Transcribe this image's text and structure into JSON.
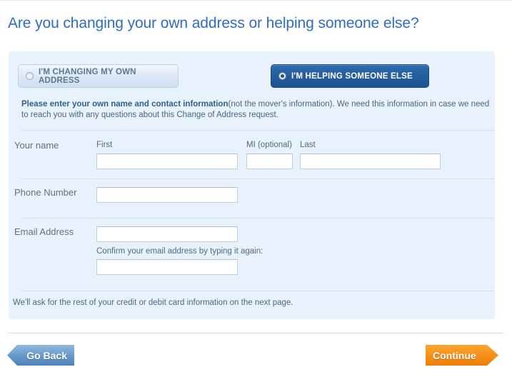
{
  "page": {
    "title": "Are you changing your own address or helping someone else?"
  },
  "choices": {
    "own": {
      "label": "I'M CHANGING MY OWN ADDRESS",
      "selected": false,
      "radio_icon": "radio-unselected-icon"
    },
    "other": {
      "label": "I'M HELPING SOMEONE ELSE",
      "selected": true,
      "radio_icon": "radio-selected-icon"
    }
  },
  "intro": {
    "bold": "Please enter your own name and contact information",
    "rest": "(not the mover's information). We need this information in case we need to reach you with any questions about this Change of Address request."
  },
  "form": {
    "name_row_label": "Your name",
    "first_label": "First",
    "first_value": "",
    "mi_label": "MI (optional)",
    "mi_value": "",
    "last_label": "Last",
    "last_value": "",
    "phone_row_label": "Phone Number",
    "phone_value": "",
    "email_row_label": "Email Address",
    "email_value": "",
    "email_confirm_label": "Confirm your email address by typing it again:",
    "email_confirm_value": ""
  },
  "footnote": "We'll ask for the rest of your credit or debit card information on the next page.",
  "buttons": {
    "back": "Go Back",
    "continue": "Continue"
  },
  "colors": {
    "heading": "#2f6cc4",
    "panel": "#e8f2fc",
    "selected_choice": "#245d9e",
    "continue": "#f6911a",
    "back": "#6b9bcb"
  }
}
